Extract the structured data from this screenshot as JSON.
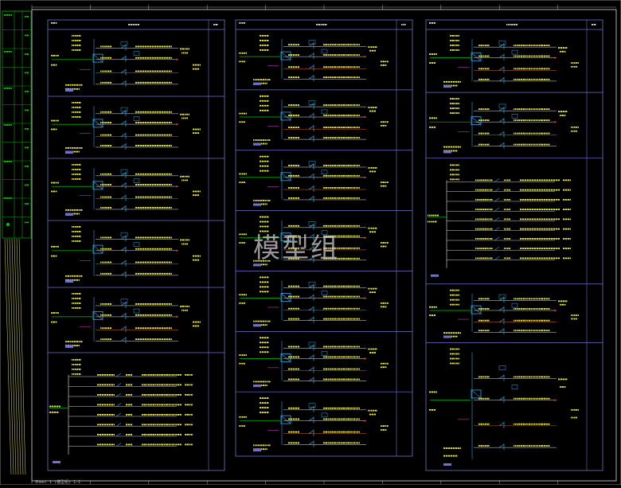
{
  "watermark": "模型组",
  "footer_text": "Sheet 1 (模型组) 1:1",
  "colors": {
    "background": "#000000",
    "frame": "#d8d8d8",
    "panel": "#6e72c8",
    "green": "#00c800",
    "cyan": "#31a8e6",
    "busbar": "#d36b2b",
    "wire": "#e6e6e6",
    "label": "#e8e84a",
    "red": "#e03030",
    "magenta": "#d54cd5"
  },
  "left_strip": {
    "rows": [
      "A",
      "B",
      "C",
      "D",
      "E",
      "F",
      "G",
      "H",
      "I",
      "J",
      "K",
      "L"
    ]
  },
  "columns": [
    {
      "id": "col-1",
      "units": [
        {
          "kind": "motor",
          "height": 84
        },
        {
          "kind": "motor",
          "height": 78
        },
        {
          "kind": "motor",
          "height": 78
        },
        {
          "kind": "motor",
          "height": 84
        },
        {
          "kind": "motor",
          "height": 82
        },
        {
          "kind": "feeder",
          "branches": 8,
          "height": 148
        }
      ]
    },
    {
      "id": "col-2",
      "units": [
        {
          "kind": "motor",
          "height": 77
        },
        {
          "kind": "motor",
          "height": 77
        },
        {
          "kind": "motor",
          "height": 77
        },
        {
          "kind": "motor",
          "height": 77
        },
        {
          "kind": "motor",
          "height": 77
        },
        {
          "kind": "motor",
          "height": 77
        },
        {
          "kind": "motor",
          "height": 82
        }
      ]
    },
    {
      "id": "col-3",
      "units": [
        {
          "kind": "motor",
          "height": 75
        },
        {
          "kind": "motor",
          "height": 78
        },
        {
          "kind": "feeder",
          "branches": 9,
          "height": 150
        },
        {
          "kind": "motor",
          "height": 70
        },
        {
          "kind": "motor",
          "height": 152
        }
      ]
    }
  ]
}
